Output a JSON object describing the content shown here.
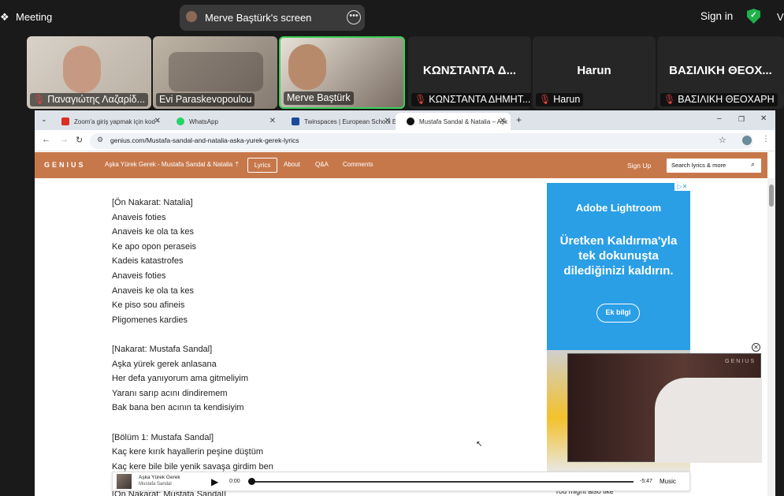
{
  "zoom": {
    "meeting_label": "Meeting",
    "share_label": "Merve Baştürk's screen",
    "signin": "Sign in",
    "view_cut": "V"
  },
  "participants": [
    {
      "name": "Παναγιώτης Λαζαρίδ...",
      "muted": true
    },
    {
      "name": "Evi Paraskevopoulou",
      "muted": false
    },
    {
      "name": "Merve Baştürk",
      "muted": false,
      "active": true
    },
    {
      "big": "ΚΩΝΣΤΑΝΤΑ Δ...",
      "name": "ΚΩΝΣΤΑΝΤΑ ΔΗΜΗΤ...",
      "muted": true
    },
    {
      "big": "Harun",
      "name": "Harun",
      "muted": true
    },
    {
      "big": "ΒΑΣΙΛΙΚΗ ΘΕΟΧ...",
      "name": "ΒΑΣΙΛΙΚΗ ΘΕΟΧΑΡΗ",
      "muted": true
    }
  ],
  "browser": {
    "tabs": [
      {
        "label": "Zoom'a giriş yapmak için kod ·",
        "icon_color": "#d93025"
      },
      {
        "label": "WhatsApp",
        "icon_color": "#25d366"
      },
      {
        "label": "Twinspaces | European School E",
        "icon_color": "#1a4a9c"
      },
      {
        "label": "Mustafa Sandal & Natalia – Aşk",
        "icon_color": "#111111"
      }
    ],
    "url": "genius.com/Mustafa-sandal-and-natalia-aska-yurek-gerek-lyrics",
    "window_controls": [
      "–",
      "❐",
      "✕"
    ]
  },
  "genius": {
    "logo": "GENIUS",
    "song_title": "Aşka Yürek Gerek - Mustafa Sandal & Natalia ⇡",
    "nav": [
      "Lyrics",
      "About",
      "Q&A",
      "Comments"
    ],
    "signup": "Sign Up",
    "search_placeholder": "Search lyrics & more",
    "brand_color": "#c7784b"
  },
  "lyrics": [
    "[Ön Nakarat: Natalia]",
    "Anaveis foties",
    "Anaveis ke ola ta kes",
    "Ke apo opon peraseis",
    "Kadeis katastrofes",
    "Anaveis foties",
    "Anaveis ke ola ta kes",
    "Ke piso sou afineis",
    "Pligomenes kardies",
    "",
    "[Nakarat: Mustafa Sandal]",
    "Aşka yürek gerek anlasana",
    "Her defa yanıyorum ama gitmeliyim",
    "Yaranı sarıp acını dindiremem",
    "Bak bana ben acının ta kendisiyim",
    "",
    "[Bölüm 1: Mustafa Sandal]",
    "Kaç kere kırık hayallerin peşine düştüm",
    "Kaç kere bile bile yenik savaşa girdim ben",
    "[Ön Nakarat: Mustafa Sandal]"
  ],
  "ad": {
    "brand": "Adobe Lightroom",
    "text": "Üretken Kaldırma'yla tek dokunuşta dilediğinizi kaldırın.",
    "button": "Ek bilgi",
    "choices": "▷✕"
  },
  "video": {
    "watermark": "GENIUS"
  },
  "you_might": "You might also like",
  "player": {
    "title": "Aşka Yürek Gerek",
    "artist": "Mustafa Sandal",
    "time_current": "0:00",
    "time_remaining": "-5:47",
    "service": "Music",
    "progress": 0
  }
}
